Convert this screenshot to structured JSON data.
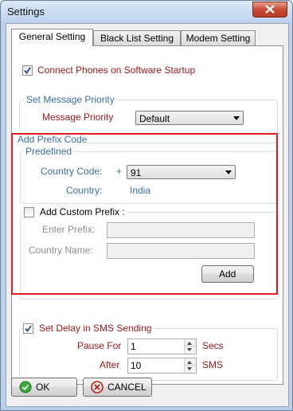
{
  "window": {
    "title": "Settings"
  },
  "tabs": [
    {
      "label": "General Setting",
      "active": true
    },
    {
      "label": "Black List Setting",
      "active": false
    },
    {
      "label": "Modem Setting",
      "active": false
    }
  ],
  "general": {
    "connect_phones": {
      "label": "Connect Phones on Software Startup",
      "checked": true
    },
    "message_priority_group": {
      "legend": "Set Message Priority",
      "label": "Message Priority",
      "value": "Default"
    },
    "prefix_group": {
      "legend": "Add Prefix Code",
      "predefined": {
        "legend": "Predefined",
        "country_code_label": "Country Code:",
        "plus": "+",
        "country_code_value": "91",
        "country_label": "Country:",
        "country_value": "India"
      },
      "custom": {
        "label": "Add Custom Prefix :",
        "checked": false,
        "enter_prefix_label": "Enter Prefix:",
        "enter_prefix_value": "",
        "country_name_label": "Country Name:",
        "country_name_value": "",
        "add_button": "Add"
      }
    },
    "delay_group": {
      "legend": "Set Delay in SMS Sending",
      "checked": true,
      "pause_for_label": "Pause For",
      "pause_for_value": "1",
      "pause_for_unit": "Secs",
      "after_label": "After",
      "after_value": "10",
      "after_unit": "SMS"
    }
  },
  "footer": {
    "ok_label": "OK",
    "cancel_label": "CANCEL"
  },
  "colors": {
    "accent_blue": "#3a6ea5",
    "label_red": "#a0191b",
    "highlight_red": "#e51b22"
  }
}
